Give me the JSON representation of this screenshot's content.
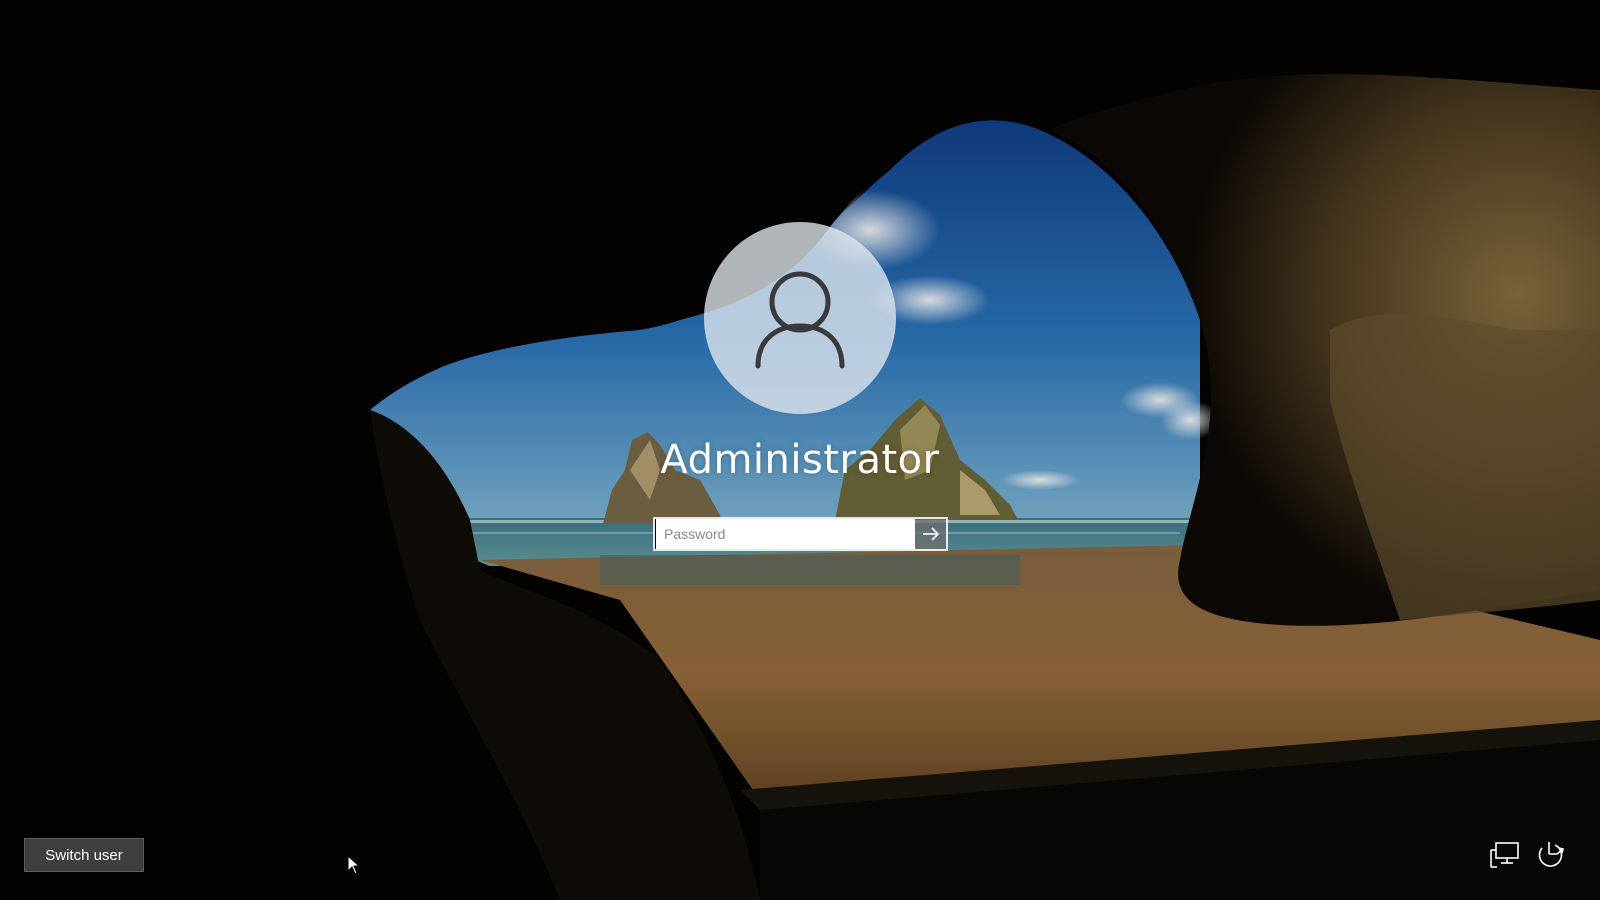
{
  "lock_screen": {
    "username": "Administrator",
    "password_placeholder": "Password",
    "password_value": "",
    "submit_icon": "arrow-right-icon",
    "avatar_icon": "user-icon"
  },
  "bottom_left": {
    "switch_user_label": "Switch user"
  },
  "bottom_right": {
    "icons": [
      "network-icon",
      "power-icon"
    ]
  },
  "colors": {
    "sky": "#2b6fb5",
    "sea": "#4d93a8",
    "sand": "#9b7242",
    "rock": "#4a3a22",
    "button_bg": "#464646"
  }
}
